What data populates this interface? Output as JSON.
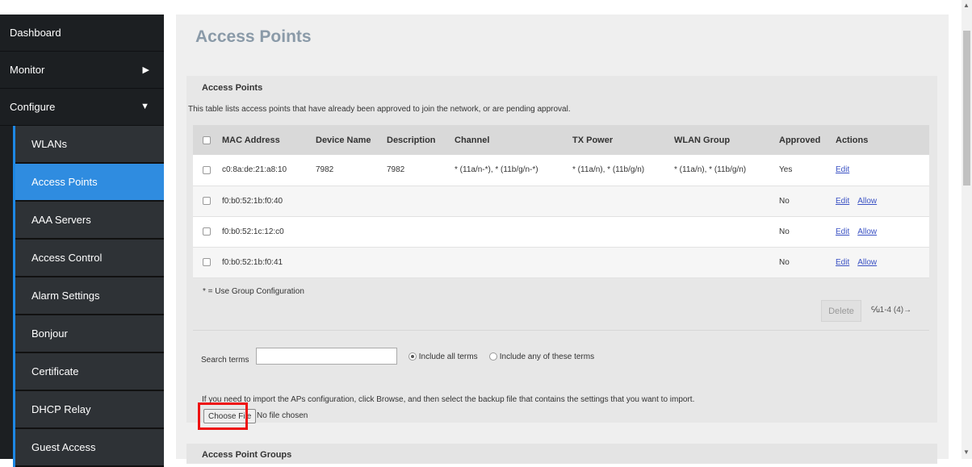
{
  "sidebar": {
    "items": [
      {
        "label": "Dashboard"
      },
      {
        "label": "Monitor",
        "arrow": "▶"
      },
      {
        "label": "Configure",
        "arrow": "▼"
      }
    ],
    "sub_items": [
      {
        "label": "WLANs"
      },
      {
        "label": "Access Points",
        "active": true
      },
      {
        "label": "AAA Servers"
      },
      {
        "label": "Access Control"
      },
      {
        "label": "Alarm Settings"
      },
      {
        "label": "Bonjour"
      },
      {
        "label": "Certificate"
      },
      {
        "label": "DHCP Relay"
      },
      {
        "label": "Guest Access"
      }
    ]
  },
  "page": {
    "title": "Access Points"
  },
  "panel": {
    "title": "Access Points",
    "description": "This table lists access points that have already been approved to join the network, or are pending approval."
  },
  "table": {
    "columns": [
      "MAC Address",
      "Device Name",
      "Description",
      "Channel",
      "TX Power",
      "WLAN Group",
      "Approved",
      "Actions"
    ],
    "rows": [
      {
        "mac": "c0:8a:de:21:a8:10",
        "device": "7982",
        "desc": "7982",
        "channel": "* (11a/n-*), * (11b/g/n-*)",
        "tx": "* (11a/n), * (11b/g/n)",
        "group": "* (11a/n), * (11b/g/n)",
        "approved": "Yes",
        "edit": "Edit",
        "allow": ""
      },
      {
        "mac": "f0:b0:52:1b:f0:40",
        "device": "",
        "desc": "",
        "channel": "",
        "tx": "",
        "group": "",
        "approved": "No",
        "edit": "Edit",
        "allow": "Allow"
      },
      {
        "mac": "f0:b0:52:1c:12:c0",
        "device": "",
        "desc": "",
        "channel": "",
        "tx": "",
        "group": "",
        "approved": "No",
        "edit": "Edit",
        "allow": "Allow"
      },
      {
        "mac": "f0:b0:52:1b:f0:41",
        "device": "",
        "desc": "",
        "channel": "",
        "tx": "",
        "group": "",
        "approved": "No",
        "edit": "Edit",
        "allow": "Allow"
      }
    ]
  },
  "footnote": "* = Use Group Configuration",
  "delete_label": "Delete",
  "pager": "℆1-4 (4)→",
  "search": {
    "label": "Search terms",
    "value": "",
    "radio_all": "Include all terms",
    "radio_any": "Include any of these terms"
  },
  "import": {
    "text": "If you need to import the APs configuration, click Browse, and then select the backup file that contains the settings that you want to import.",
    "button": "Choose File",
    "no_file": "No file chosen"
  },
  "panel2": {
    "title": "Access Point Groups"
  },
  "colors": {
    "accent": "#2f8ce0",
    "highlight": "#ee1111",
    "link": "#3b52c4"
  }
}
